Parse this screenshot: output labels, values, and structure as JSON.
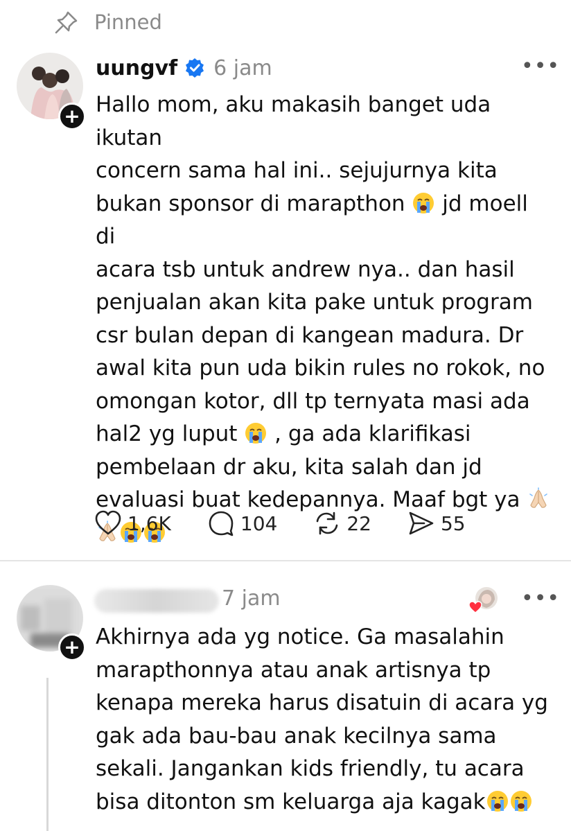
{
  "pinned": {
    "icon": "pin-icon",
    "label": "Pinned"
  },
  "post": {
    "username": "uungvf",
    "verified": true,
    "time": "6 jam",
    "text_lines": [
      "Hallo mom, aku makasih banget uda ikutan",
      "concern sama hal ini.. sejujurnya kita",
      "bukan sponsor di marapthon [cry] jd moell di",
      "acara tsb untuk andrew nya.. dan hasil",
      "penjualan akan kita pake untuk program",
      "csr bulan depan di kangean madura. Dr",
      "awal kita pun uda bikin rules no rokok, no",
      "omongan kotor, dll tp ternyata masi ada",
      "hal2 yg luput [cry] , ga ada klarifikasi",
      "pembelaan dr aku, kita salah dan jd",
      "evaluasi buat kedepannya. Maaf bgt ya [pray]",
      "[pray][cry][cry]"
    ],
    "likes": "1,6K",
    "comments": "104",
    "reposts": "22",
    "shares": "55"
  },
  "reply": {
    "time": "7 jam",
    "text": [
      "Akhirnya ada yg notice. Ga masalahin",
      "marapthonnya atau anak artisnya tp",
      "kenapa mereka harus disatuin di acara yg",
      "gak ada bau-bau anak kecilnya sama",
      "sekali. Jangankan kids friendly, tu acara",
      "bisa ditonton sm keluarga aja kagak[cry][cry]"
    ]
  },
  "colors": {
    "verified": "#1877f2",
    "muted": "#8a8a8a",
    "heart": "#ff3040"
  },
  "icons": [
    "heart-icon",
    "comment-icon",
    "repost-icon",
    "share-icon",
    "more-icon",
    "verified-icon",
    "plus-icon"
  ]
}
